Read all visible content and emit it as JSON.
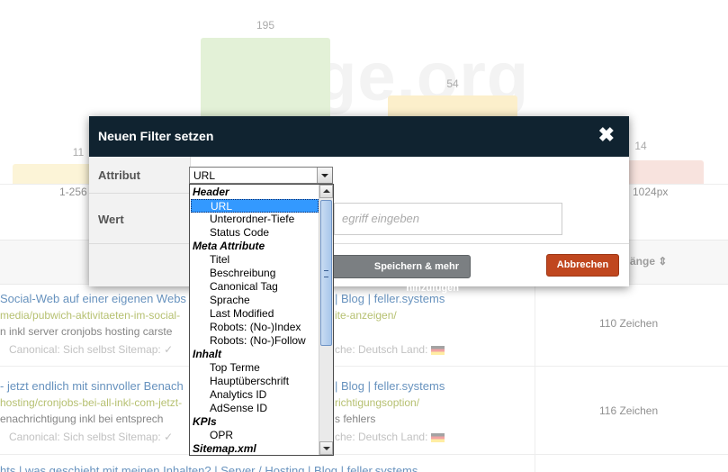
{
  "background": {
    "chart_labels": {
      "bar1": "11",
      "bar2": "195",
      "bar3": "54",
      "bar4": "14"
    },
    "watermark": "Page.org",
    "range_left": "1-256",
    "range_right": "1024px",
    "column_label": "änge ⇕",
    "rows": [
      {
        "title": "Social-Web auf einer eigenen Webs",
        "title_tail": "| Blog | feller.systems",
        "url": "media/pubwich-aktivitaeten-im-social-",
        "url_tail": "ite-anzeigen/",
        "desc": "n inkl server cronjobs hosting carste",
        "meta": "Canonical: Sich selbst  Sitemap: ✓",
        "meta_tail": "che: Deutsch  Land:",
        "right": "110 Zeichen"
      },
      {
        "title": "- jetzt endlich mit sinnvoller Benach",
        "title_tail": "| Blog | feller.systems",
        "url": "hosting/cronjobs-bei-all-inkl-com-jetzt-",
        "url_tail": "richtigungsoption/",
        "desc": "enachrichtigung inkl bei entsprech",
        "desc_tail": "s fehlers",
        "meta": "Canonical: Sich selbst  Sitemap: ✓",
        "meta_tail": "che: Deutsch  Land:",
        "right": "116 Zeichen"
      },
      {
        "title": "hts | was geschieht mit meinen Inhalten? | Server / Hosting | Blog | feller.systems"
      }
    ]
  },
  "modal": {
    "title": "Neuen Filter setzen",
    "close_label": "✖",
    "attribute_label": "Attribut",
    "value_label": "Wert",
    "selected_value": "URL",
    "value_placeholder": "egriff eingeben",
    "save_more_label": "Speichern & mehr hinzufügen",
    "cancel_label": "Abbrechen"
  },
  "dropdown": {
    "options": [
      {
        "label": "Header",
        "type": "group"
      },
      {
        "label": "URL",
        "type": "item",
        "selected": true
      },
      {
        "label": "Unterordner-Tiefe",
        "type": "item"
      },
      {
        "label": "Status Code",
        "type": "item"
      },
      {
        "label": "Meta Attribute",
        "type": "group"
      },
      {
        "label": "Titel",
        "type": "item"
      },
      {
        "label": "Beschreibung",
        "type": "item"
      },
      {
        "label": "Canonical Tag",
        "type": "item"
      },
      {
        "label": "Sprache",
        "type": "item"
      },
      {
        "label": "Last Modified",
        "type": "item"
      },
      {
        "label": "Robots: (No-)Index",
        "type": "item"
      },
      {
        "label": "Robots: (No-)Follow",
        "type": "item"
      },
      {
        "label": "Inhalt",
        "type": "group"
      },
      {
        "label": "Top Terme",
        "type": "item"
      },
      {
        "label": "Hauptüberschrift",
        "type": "item"
      },
      {
        "label": "Analytics ID",
        "type": "item"
      },
      {
        "label": "AdSense ID",
        "type": "item"
      },
      {
        "label": "KPIs",
        "type": "group"
      },
      {
        "label": "OPR",
        "type": "item"
      },
      {
        "label": "Sitemap.xml",
        "type": "group"
      }
    ]
  }
}
